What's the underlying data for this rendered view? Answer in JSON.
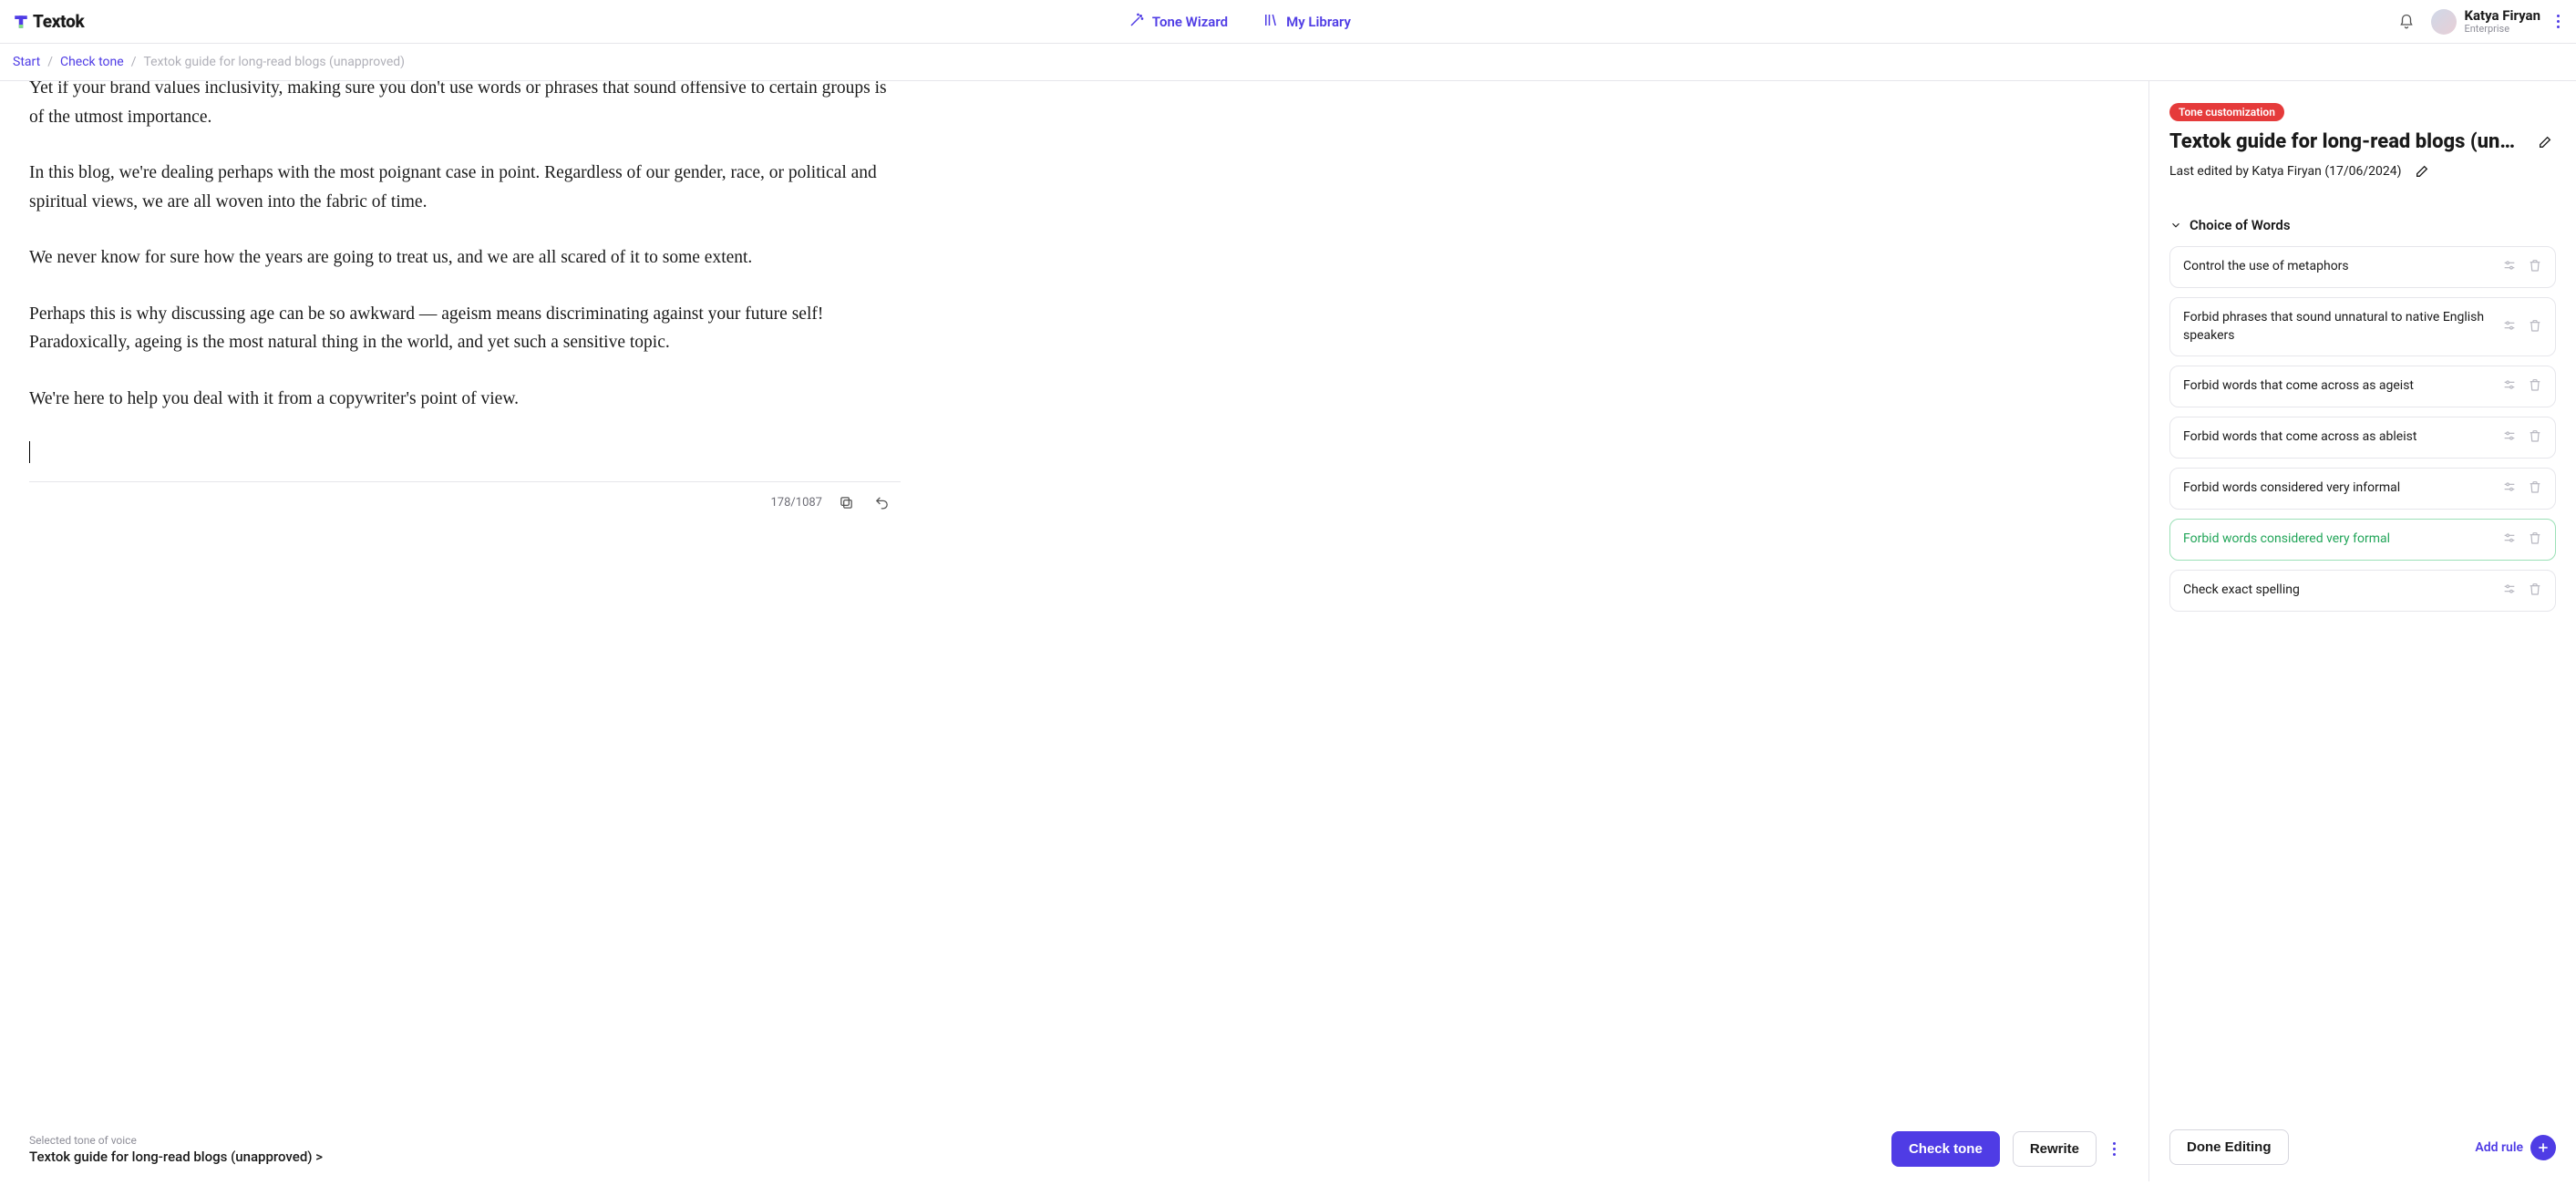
{
  "brand": "Textok",
  "nav": {
    "tone_wizard": "Tone Wizard",
    "my_library": "My Library"
  },
  "user": {
    "name": "Katya Firyan",
    "plan": "Enterprise"
  },
  "breadcrumb": {
    "start": "Start",
    "check_tone": "Check tone",
    "current": "Textok guide for long-read blogs (unapproved)"
  },
  "editor": {
    "paragraphs": [
      "Yet if your brand values inclusivity, making sure you don't use words or phrases that sound offensive to certain groups is of the utmost importance.",
      "In this blog, we're dealing perhaps with the most poignant case in point. Regardless of our gender, race, or political and spiritual views, we are all woven into the fabric of time.",
      "We never know for sure how the years are going to treat us, and we are all scared of it to some extent.",
      "Perhaps this is why discussing age can be so awkward — ageism means discriminating against your future self! Paradoxically, ageing is the most natural thing in the world, and yet such a sensitive topic.",
      "We're here to help you deal with it from a copywriter's point of view."
    ],
    "counter": "178/1087"
  },
  "footer": {
    "label": "Selected tone of voice",
    "value": "Textok guide for long-read blogs (unapproved) >",
    "check_tone": "Check tone",
    "rewrite": "Rewrite"
  },
  "panel": {
    "badge": "Tone customization",
    "title": "Textok guide for long-read blogs (unap…",
    "subtitle": "Last edited by Katya Firyan (17/06/2024)",
    "section": "Choice of Words",
    "rules": [
      {
        "label": "Control the use of metaphors",
        "active": false
      },
      {
        "label": "Forbid phrases that sound unnatural to native English speakers",
        "active": false
      },
      {
        "label": "Forbid words that come across as ageist",
        "active": false
      },
      {
        "label": "Forbid words that come across as ableist",
        "active": false
      },
      {
        "label": "Forbid words considered very informal",
        "active": false
      },
      {
        "label": "Forbid words considered very formal",
        "active": true
      },
      {
        "label": "Check exact spelling",
        "active": false
      }
    ],
    "done": "Done Editing",
    "add_rule": "Add rule"
  }
}
